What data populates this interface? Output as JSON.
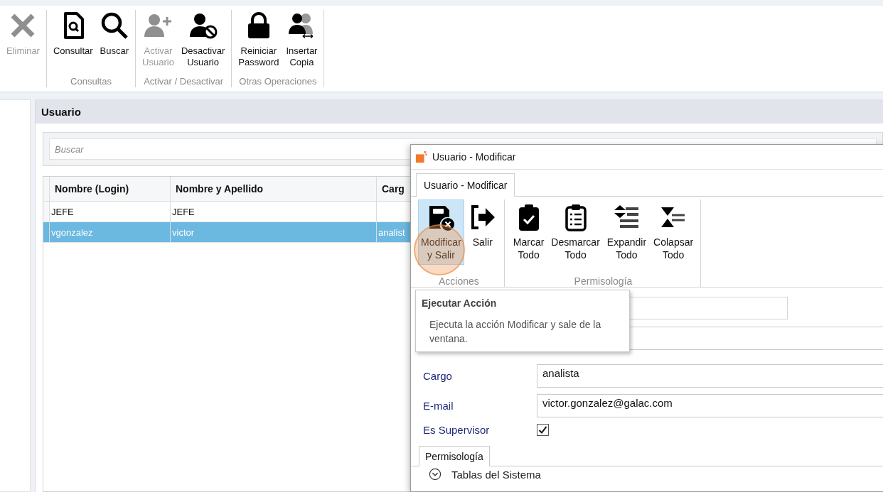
{
  "ribbon": {
    "groups": [
      {
        "buttons": [
          {
            "kind": "delete",
            "label": "Eliminar",
            "disabled": true
          }
        ]
      },
      {
        "label": "Consultas",
        "buttons": [
          {
            "kind": "query",
            "label": "Consultar",
            "disabled": false
          },
          {
            "kind": "search",
            "label": "Buscar",
            "disabled": false
          }
        ]
      },
      {
        "label": "Activar / Desactivar",
        "buttons": [
          {
            "kind": "useradd",
            "label": "Activar\nUsuario",
            "disabled": true
          },
          {
            "kind": "userblock",
            "label": "Desactivar\nUsuario",
            "disabled": false
          }
        ]
      },
      {
        "label": "Otras Operaciones",
        "buttons": [
          {
            "kind": "lock",
            "label": "Reiniciar\nPassword",
            "disabled": false
          },
          {
            "kind": "usercopy",
            "label": "Insertar\nCopia",
            "disabled": false
          }
        ]
      }
    ]
  },
  "panel": {
    "title": "Usuario",
    "search": {
      "placeholder": "Buscar"
    },
    "table": {
      "columns": [
        "Nombre (Login)",
        "Nombre y Apellido",
        "Carg"
      ],
      "rows": [
        {
          "cells": [
            "JEFE",
            "JEFE",
            ""
          ],
          "selected": false
        },
        {
          "cells": [
            "vgonzalez",
            "victor",
            "analist"
          ],
          "selected": true
        }
      ]
    }
  },
  "dialog": {
    "title": "Usuario - Modificar",
    "tabs": [
      {
        "label": "Usuario - Modificar",
        "selected": true
      }
    ],
    "groups": [
      {
        "label": "Acciones",
        "buttons": [
          {
            "kind": "saveclose",
            "label": "Modificar\ny Salir",
            "hovered": true
          },
          {
            "kind": "exit",
            "label": "Salir",
            "hovered": false
          }
        ]
      },
      {
        "label": "Permisología",
        "buttons": [
          {
            "kind": "check",
            "label": "Marcar\nTodo",
            "hovered": false
          },
          {
            "kind": "list",
            "label": "Desmarcar\nTodo",
            "hovered": false
          },
          {
            "kind": "expand",
            "label": "Expandir\nTodo",
            "hovered": false
          },
          {
            "kind": "collapse",
            "label": "Colapsar\nTodo",
            "hovered": false
          }
        ]
      }
    ],
    "fields": [
      {
        "kind": "text",
        "label": "Cargo",
        "value": "analista"
      },
      {
        "kind": "text",
        "label": "E-mail",
        "value": "victor.gonzalez@galac.com"
      },
      {
        "kind": "checkbox",
        "label": "Es Supervisor",
        "checked": true
      }
    ],
    "bottom_tabs": [
      {
        "label": "Permisología",
        "selected": true
      }
    ],
    "tree": [
      {
        "label": "Tablas del Sistema",
        "expanded": false
      }
    ],
    "tooltip": {
      "title": "Ejecutar Acción",
      "text": "Ejecuta la acción Modificar y sale de la ventana."
    }
  }
}
